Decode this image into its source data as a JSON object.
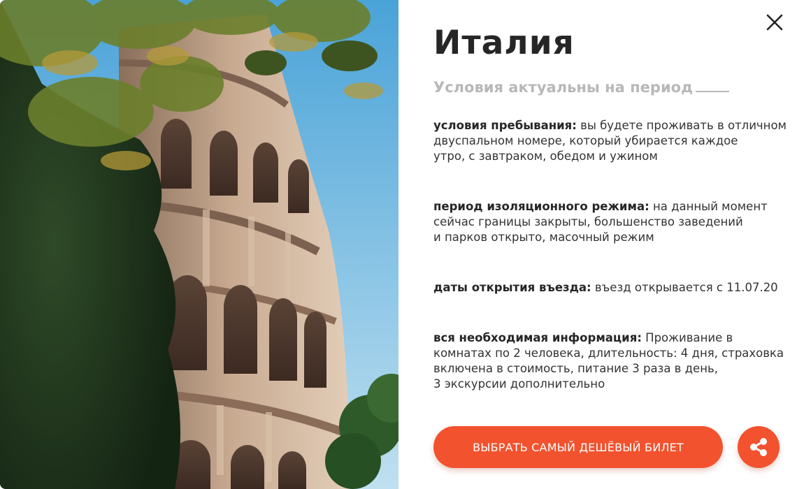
{
  "dialog": {
    "title": "Италия",
    "period_text": "Условия актуальны  на период",
    "sections": [
      {
        "label": "условия пребывания:",
        "lines": [
          " вы будете проживать в отличном",
          "двуспальном номере, который убирается каждое",
          "утро, с завтраком, обедом и ужином"
        ]
      },
      {
        "label": "период изоляционного режима:",
        "lines": [
          " на данный момент",
          "сейчас границы закрыты, большенство заведений",
          "и парков открыто, масочный режим"
        ]
      },
      {
        "label": "даты открытия въезда:",
        "lines": [
          " въезд открывается с 11.07.20"
        ]
      },
      {
        "label": "вся необходимая информация:",
        "lines": [
          " Проживание в",
          "комнатах по 2 человека, длительность: 4 дня, страховка",
          "включена в стоимость, питание 3 раза в день,",
          "3 экскурсии дополнительно"
        ]
      }
    ],
    "cta_label": "ВЫБРАТЬ САМЫЙ ДЕШЁВЫЙ БИЛЕТ",
    "icons": {
      "close": "close-icon",
      "share": "share-icon"
    },
    "colors": {
      "accent": "#f2522e",
      "title": "#262626",
      "muted": "#b8b8b8",
      "body": "#333333"
    }
  }
}
